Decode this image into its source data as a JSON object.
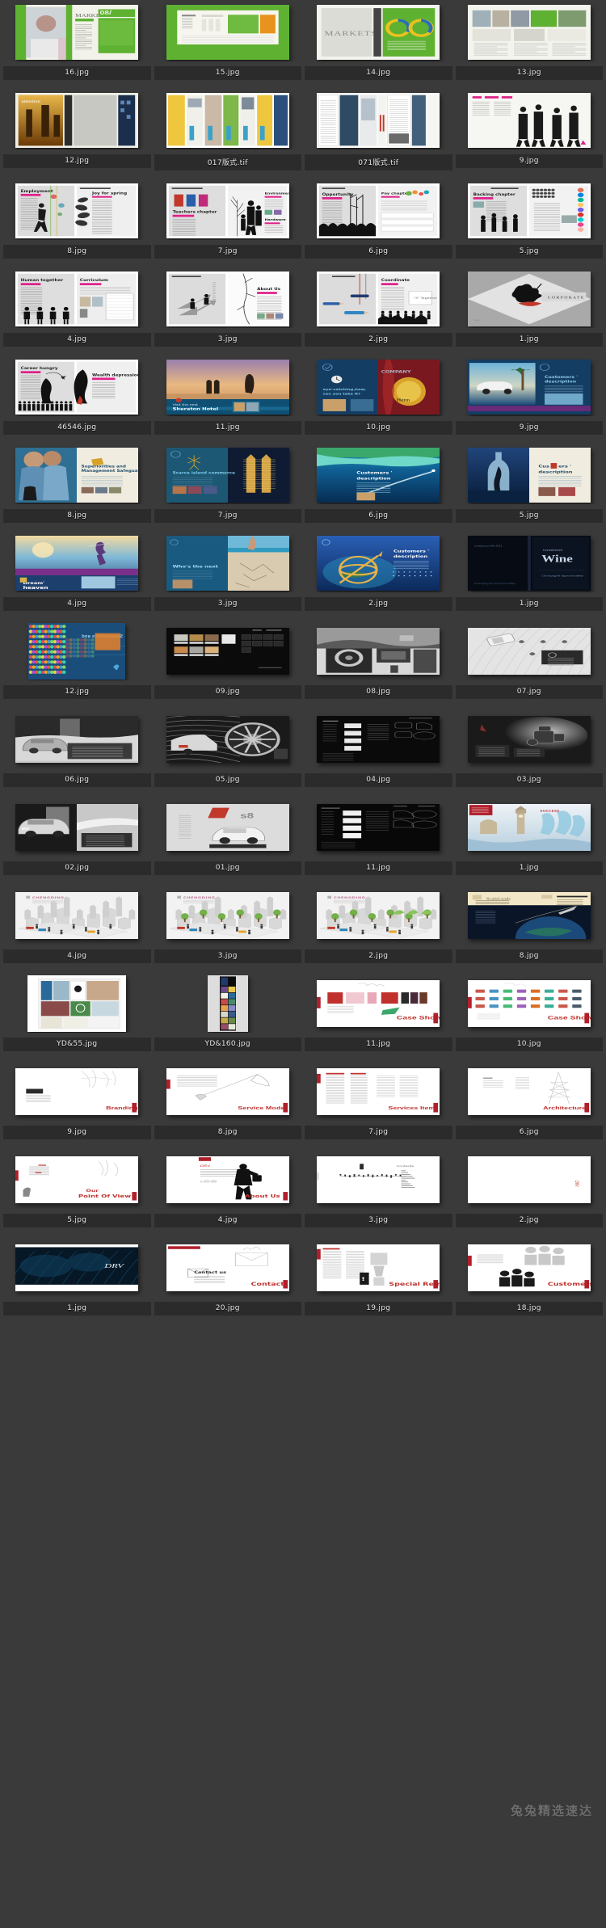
{
  "view": {
    "background_color": "#3a3a3a",
    "label_background_color": "#2b2b2b",
    "label_text_color": "#e8e8e8",
    "columns": 4,
    "watermark": "兔兔精选速达"
  },
  "rows": [
    {
      "index": 1,
      "items": [
        {
          "name": "16.jpg",
          "art": "green-markets-doctor"
        },
        {
          "name": "15.jpg",
          "art": "green-solid-spread"
        },
        {
          "name": "14.jpg",
          "art": "markets-donut"
        },
        {
          "name": "13.jpg",
          "art": "green-photo-grid"
        }
      ]
    },
    {
      "index": 2,
      "items": [
        {
          "name": "12.jpg",
          "art": "attention-night-city"
        },
        {
          "name": "017版式.tif",
          "art": "yellow-color-layout"
        },
        {
          "name": "071版式.tif",
          "art": "grey-editorial-layout"
        },
        {
          "name": "9.jpg",
          "art": "crowd-silhouette"
        }
      ]
    },
    {
      "index": 3,
      "items": [
        {
          "name": "8.jpg",
          "art": "employment-magenta"
        },
        {
          "name": "7.jpg",
          "art": "teachers-chapter"
        },
        {
          "name": "6.jpg",
          "art": "opportunity-crowd"
        },
        {
          "name": "5.jpg",
          "art": "backing-chapter"
        }
      ]
    },
    {
      "index": 4,
      "items": [
        {
          "name": "4.jpg",
          "art": "human-together"
        },
        {
          "name": "3.jpg",
          "art": "about-us-arrows"
        },
        {
          "name": "2.jpg",
          "art": "coordinate-pencils"
        },
        {
          "name": "1.jpg",
          "art": "grey-diamond-cover"
        }
      ]
    },
    {
      "index": 5,
      "items": [
        {
          "name": "46546.jpg",
          "art": "career-hungry"
        },
        {
          "name": "11.jpg",
          "art": "sheraton-hotel-sunset"
        },
        {
          "name": "10.jpg",
          "art": "hennessy-red"
        },
        {
          "name": "9.jpg",
          "art": "beach-car-blue"
        }
      ]
    },
    {
      "index": 6,
      "items": [
        {
          "name": "8.jpg",
          "art": "management-safeguard"
        },
        {
          "name": "7.jpg",
          "art": "scarce-island-commerce"
        },
        {
          "name": "6.jpg",
          "art": "customers-description-sea"
        },
        {
          "name": "5.jpg",
          "art": "bottle-dancer-blue"
        }
      ]
    },
    {
      "index": 7,
      "items": [
        {
          "name": "4.jpg",
          "art": "dream-heaven"
        },
        {
          "name": "3.jpg",
          "art": "whos-the-next-beach"
        },
        {
          "name": "2.jpg",
          "art": "compass-island"
        },
        {
          "name": "1.jpg",
          "art": "investment-wine-dark"
        }
      ]
    },
    {
      "index": 8,
      "items": [
        {
          "name": "12.jpg",
          "art": "fashion-floral"
        },
        {
          "name": "09.jpg",
          "art": "dark-catalog-grid"
        },
        {
          "name": "08.jpg",
          "art": "car-interior-bw"
        },
        {
          "name": "07.jpg",
          "art": "car-topview-bw"
        }
      ]
    },
    {
      "index": 9,
      "items": [
        {
          "name": "06.jpg",
          "art": "car-road-bw"
        },
        {
          "name": "05.jpg",
          "art": "car-wheel-bw"
        },
        {
          "name": "04.jpg",
          "art": "dark-specs-panel"
        },
        {
          "name": "03.jpg",
          "art": "car-engine-bw"
        }
      ]
    },
    {
      "index": 10,
      "items": [
        {
          "name": "02.jpg",
          "art": "two-cars-bw"
        },
        {
          "name": "01.jpg",
          "art": "audi-s8-light"
        },
        {
          "name": "11.jpg",
          "art": "black-spec-sheet"
        },
        {
          "name": "1.jpg",
          "art": "bigben-water-splash"
        }
      ]
    },
    {
      "index": 11,
      "items": [
        {
          "name": "4.jpg",
          "art": "city-iso-3d-a"
        },
        {
          "name": "3.jpg",
          "art": "city-iso-3d-b"
        },
        {
          "name": "2.jpg",
          "art": "city-iso-3d-c"
        },
        {
          "name": "8.jpg",
          "art": "scaleleads-earth"
        }
      ]
    },
    {
      "index": 12,
      "items": [
        {
          "name": "YD&55.jpg",
          "art": "portfolio-grid-white"
        },
        {
          "name": "YD&160.jpg",
          "art": "vertical-dark-strip"
        },
        {
          "name": "11.jpg",
          "art": "case-show-a"
        },
        {
          "name": "10.jpg",
          "art": "case-show-logos"
        }
      ]
    },
    {
      "index": 13,
      "items": [
        {
          "name": "9.jpg",
          "art": "branding"
        },
        {
          "name": "8.jpg",
          "art": "service-model"
        },
        {
          "name": "7.jpg",
          "art": "services-item"
        },
        {
          "name": "6.jpg",
          "art": "architecture"
        }
      ]
    },
    {
      "index": 14,
      "items": [
        {
          "name": "5.jpg",
          "art": "our-point-of-view"
        },
        {
          "name": "4.jpg",
          "art": "about-us-figure"
        },
        {
          "name": "3.jpg",
          "art": "sparse-white-spread"
        },
        {
          "name": "2.jpg",
          "art": "blank-white-spread"
        }
      ]
    },
    {
      "index": 15,
      "items": [
        {
          "name": "1.jpg",
          "art": "dark-blue-drv-cover"
        },
        {
          "name": "20.jpg",
          "art": "contact"
        },
        {
          "name": "19.jpg",
          "art": "special-remind"
        },
        {
          "name": "18.jpg",
          "art": "customers"
        }
      ]
    }
  ]
}
